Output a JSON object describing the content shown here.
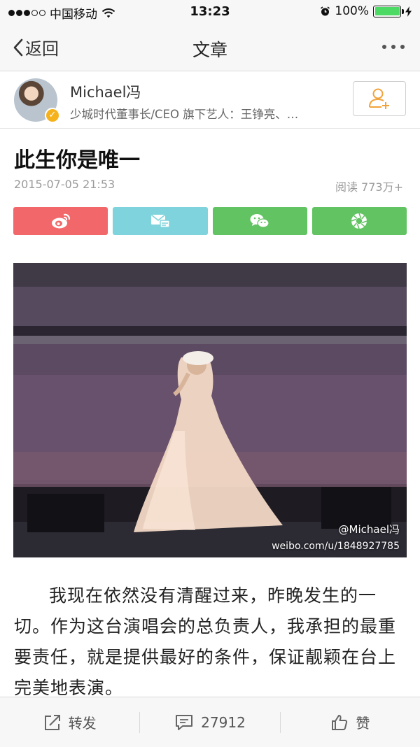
{
  "status_bar": {
    "carrier": "中国移动",
    "time": "13:23",
    "battery_percent": "100%",
    "signal_bars_filled": 3,
    "signal_bars_total": 5
  },
  "nav": {
    "back_label": "返回",
    "title": "文章"
  },
  "author": {
    "name": "Michael冯",
    "description": "少城时代董事长/CEO 旗下艺人：王铮亮、…"
  },
  "article": {
    "title": "此生你是唯一",
    "date": "2015-07-05 21:53",
    "reads": "阅读 773万+",
    "body": "我现在依然没有清醒过来，昨晚发生的一切。作为这台演唱会的总负责人，我承担的最重要责任，就是提供最好的条件，保证靓颖在台上完美地表演。"
  },
  "photo": {
    "watermark_handle": "@Michael冯",
    "watermark_url": "weibo.com/u/1848927785"
  },
  "toolbar": {
    "repost_label": "转发",
    "comment_count": "27912",
    "like_label": "赞"
  },
  "colors": {
    "share_weibo": "#f2686a",
    "share_message": "#7ed3dc",
    "share_wechat": "#62c362",
    "share_moments": "#62c362",
    "battery": "#4cd964",
    "badge": "#f6b21b",
    "follow_icon": "#f2a23a"
  },
  "icons": {
    "back": "chevron-left-icon",
    "more": "more-dots-icon",
    "follow": "add-user-icon",
    "share": [
      "weibo-icon",
      "message-icon",
      "wechat-icon",
      "moments-icon"
    ],
    "toolbar": [
      "repost-icon",
      "comment-icon",
      "like-icon"
    ]
  }
}
